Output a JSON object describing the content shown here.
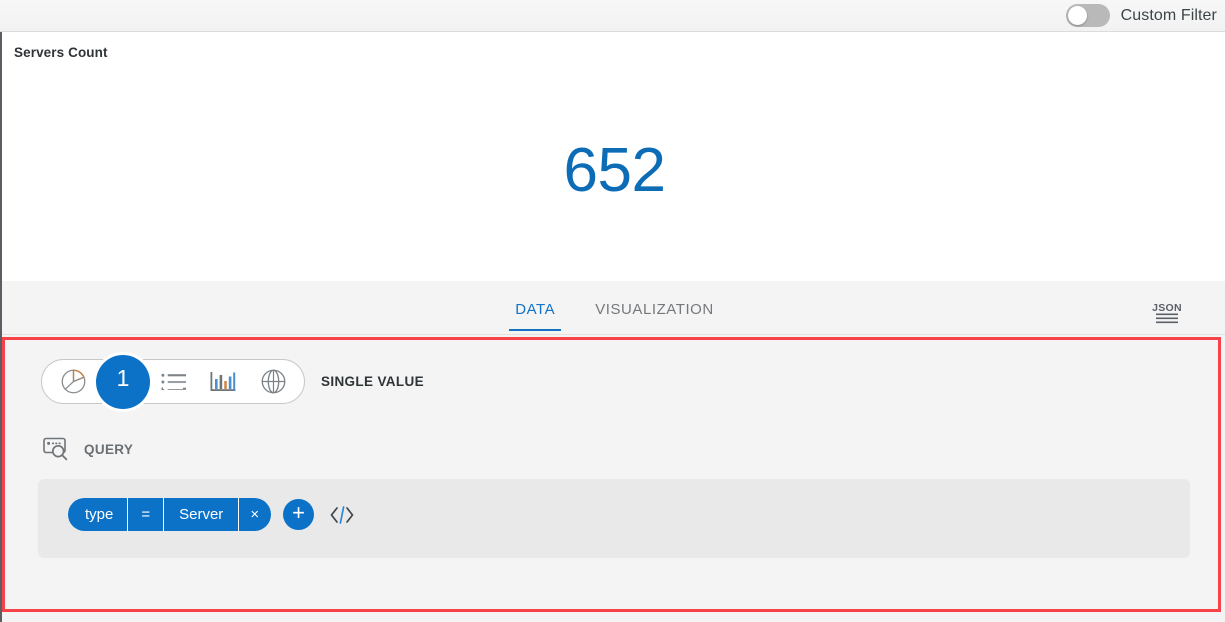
{
  "topbar": {
    "filter_label": "Custom Filter",
    "toggle_state": "off",
    "toggle_name": "custom-filter-toggle"
  },
  "widget": {
    "title": "Servers Count",
    "value": "652",
    "value_color": "#0c6cb5"
  },
  "tabs": [
    {
      "label": "DATA",
      "active": true
    },
    {
      "label": "VISUALIZATION",
      "active": false
    }
  ],
  "json_button": {
    "text": "JSON"
  },
  "visualization": {
    "selected_label": "SINGLE VALUE",
    "types": [
      {
        "name": "pie-chart",
        "selected": false
      },
      {
        "name": "single-value",
        "selected": true,
        "badge": "1"
      },
      {
        "name": "list",
        "selected": false
      },
      {
        "name": "bar-chart",
        "selected": false
      },
      {
        "name": "map",
        "selected": false
      }
    ]
  },
  "query": {
    "heading": "QUERY",
    "filters": [
      {
        "key": "type",
        "operator": "=",
        "value": "Server",
        "remove": "×"
      }
    ],
    "add_label": "+",
    "code_label": "</>"
  },
  "colors": {
    "accent": "#0c72c8",
    "tab_active": "#1273c4",
    "highlight_border": "#f9434a",
    "panel_bg": "#f4f4f4",
    "query_bg": "#e9e9e9"
  }
}
